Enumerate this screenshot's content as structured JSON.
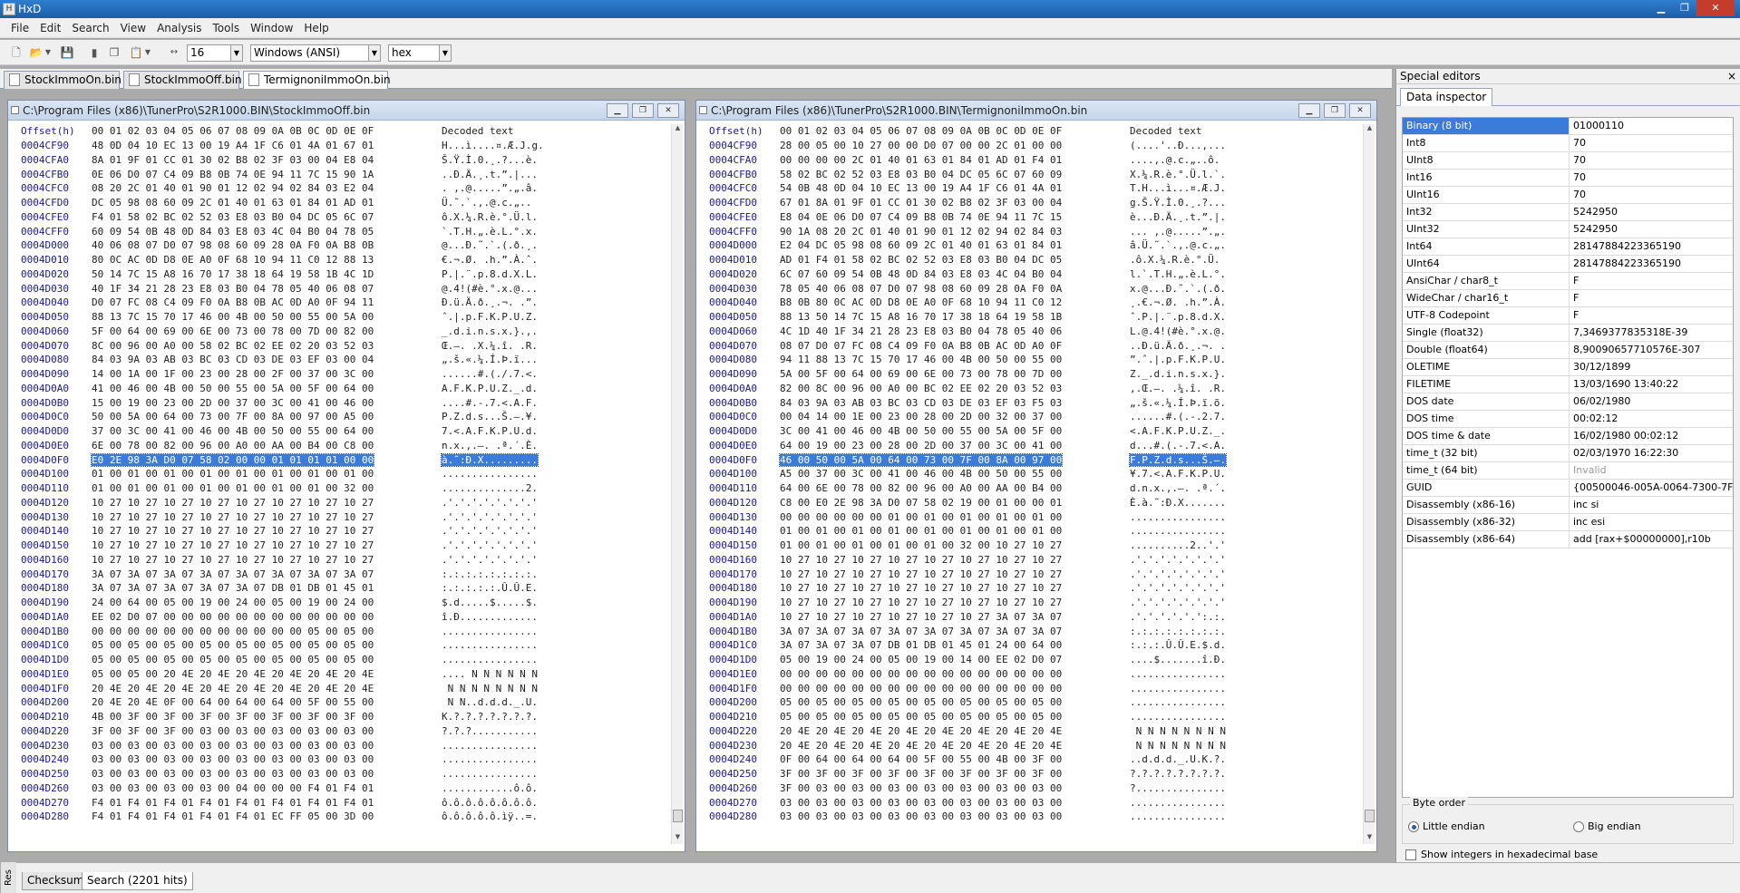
{
  "window": {
    "title": "HxD"
  },
  "menu": [
    "File",
    "Edit",
    "Search",
    "View",
    "Analysis",
    "Tools",
    "Window",
    "Help"
  ],
  "toolbar": {
    "bytes_per_row": "16",
    "charset": "Windows (ANSI)",
    "offset_base": "hex"
  },
  "tabs": [
    "StockImmoOn.bin",
    "StockImmoOff.bin",
    "TermignoniImmoOn.bin"
  ],
  "active_tab": 2,
  "header": {
    "offset": "Offset(h)",
    "cols": "00 01 02 03 04 05 06 07 08 09 0A 0B 0C 0D 0E 0F",
    "decoded": "Decoded text"
  },
  "left": {
    "path": "C:\\Program Files (x86)\\TunerPro\\S2R1000.BIN\\StockImmoOff.bin",
    "selected_row": 22,
    "rows": [
      [
        "0004CF90",
        "48 0D 04 10 EC 13 00 19 A4 1F C6 01 4A 01 67 01",
        "H...ì....¤.Æ.J.g."
      ],
      [
        "0004CFA0",
        "8A 01 9F 01 CC 01 30 02 B8 02 3F 03 00 04 E8 04",
        "Š.Ÿ.Ì.0.¸.?...è."
      ],
      [
        "0004CFB0",
        "0E 06 D0 07 C4 09 B8 0B 74 0E 94 11 7C 15 90 1A",
        "..Ð.Ä.¸.t.”.|..."
      ],
      [
        "0004CFC0",
        "08 20 2C 01 40 01 90 01 12 02 94 02 84 03 E2 04",
        ". ,.@.....”.„.â."
      ],
      [
        "0004CFD0",
        "DC 05 98 08 60 09 2C 01 40 01 63 01 84 01 AD 01",
        "Ü.˜.`.,.@.c.„.­."
      ],
      [
        "0004CFE0",
        "F4 01 58 02 BC 02 52 03 E8 03 B0 04 DC 05 6C 07",
        "ô.X.¼.R.è.°.Ü.l."
      ],
      [
        "0004CFF0",
        "60 09 54 0B 48 0D 84 03 E8 03 4C 04 B0 04 78 05",
        "`.T.H.„.è.L.°.x."
      ],
      [
        "0004D000",
        "40 06 08 07 D0 07 98 08 60 09 28 0A F0 0A B8 0B",
        "@...Ð.˜.`.(.ð.¸."
      ],
      [
        "0004D010",
        "80 0C AC 0D D8 0E A0 0F 68 10 94 11 C0 12 88 13",
        "€.¬.Ø. .h.”.À.ˆ."
      ],
      [
        "0004D020",
        "50 14 7C 15 A8 16 70 17 38 18 64 19 58 1B 4C 1D",
        "P.|.¨.p.8.d.X.L."
      ],
      [
        "0004D030",
        "40 1F 34 21 28 23 E8 03 B0 04 78 05 40 06 08 07",
        "@.4!(#è.°.x.@..."
      ],
      [
        "0004D040",
        "D0 07 FC 08 C4 09 F0 0A B8 0B AC 0D A0 0F 94 11",
        "Ð.ü.Ä.ð.¸.¬. .”."
      ],
      [
        "0004D050",
        "88 13 7C 15 70 17 46 00 4B 00 50 00 55 00 5A 00",
        "ˆ.|.p.F.K.P.U.Z."
      ],
      [
        "0004D060",
        "5F 00 64 00 69 00 6E 00 73 00 78 00 7D 00 82 00",
        "_.d.i.n.s.x.}.‚."
      ],
      [
        "0004D070",
        "8C 00 96 00 A0 00 58 02 BC 02 EE 02 20 03 52 03",
        "Œ.–. .X.¼.î. .R."
      ],
      [
        "0004D080",
        "84 03 9A 03 AB 03 BC 03 CD 03 DE 03 EF 03 00 04",
        "„.š.«.¼.Í.Þ.ï..."
      ],
      [
        "0004D090",
        "14 00 1A 00 1F 00 23 00 28 00 2F 00 37 00 3C 00",
        "......#.(./.7.<."
      ],
      [
        "0004D0A0",
        "41 00 46 00 4B 00 50 00 55 00 5A 00 5F 00 64 00",
        "A.F.K.P.U.Z._.d."
      ],
      [
        "0004D0B0",
        "15 00 19 00 23 00 2D 00 37 00 3C 00 41 00 46 00",
        "....#.-.7.<.A.F."
      ],
      [
        "0004D0C0",
        "50 00 5A 00 64 00 73 00 7F 00 8A 00 97 00 A5 00",
        "P.Z.d.s...Š.—.¥."
      ],
      [
        "0004D0D0",
        "37 00 3C 00 41 00 46 00 4B 00 50 00 55 00 64 00",
        "7.<.A.F.K.P.U.d."
      ],
      [
        "0004D0E0",
        "6E 00 78 00 82 00 96 00 A0 00 AA 00 B4 00 C8 00",
        "n.x.‚.–. .ª.´.È."
      ],
      [
        "0004D0F0",
        "E0 2E 98 3A D0 07 58 02 00 00 01 01 01 01 00 00",
        "à.˜:Ð.X........."
      ],
      [
        "0004D100",
        "01 00 01 00 01 00 01 00 01 00 01 00 01 00 01 00",
        "................"
      ],
      [
        "0004D110",
        "01 00 01 00 01 00 01 00 01 00 01 00 01 00 32 00",
        "..............2."
      ],
      [
        "0004D120",
        "10 27 10 27 10 27 10 27 10 27 10 27 10 27 10 27",
        ".'.'.'.'.'.'.'.'"
      ],
      [
        "0004D130",
        "10 27 10 27 10 27 10 27 10 27 10 27 10 27 10 27",
        ".'.'.'.'.'.'.'.'"
      ],
      [
        "0004D140",
        "10 27 10 27 10 27 10 27 10 27 10 27 10 27 10 27",
        ".'.'.'.'.'.'.'.'"
      ],
      [
        "0004D150",
        "10 27 10 27 10 27 10 27 10 27 10 27 10 27 10 27",
        ".'.'.'.'.'.'.'.'"
      ],
      [
        "0004D160",
        "10 27 10 27 10 27 10 27 10 27 10 27 10 27 10 27",
        ".'.'.'.'.'.'.'.'"
      ],
      [
        "0004D170",
        "3A 07 3A 07 3A 07 3A 07 3A 07 3A 07 3A 07 3A 07",
        ":.:.:.:.:.:.:.:."
      ],
      [
        "0004D180",
        "3A 07 3A 07 3A 07 3A 07 3A 07 DB 01 DB 01 45 01",
        ":.:.:.:.:.Û.Û.E."
      ],
      [
        "0004D190",
        "24 00 64 00 05 00 19 00 24 00 05 00 19 00 24 00",
        "$.d.....$.....$."
      ],
      [
        "0004D1A0",
        "EE 02 D0 07 00 00 00 00 00 00 00 00 00 00 00 00",
        "î.Ð............."
      ],
      [
        "0004D1B0",
        "00 00 00 00 00 00 00 00 00 00 00 00 05 00 05 00",
        "................"
      ],
      [
        "0004D1C0",
        "05 00 05 00 05 00 05 00 05 00 05 00 05 00 05 00",
        "................"
      ],
      [
        "0004D1D0",
        "05 00 05 00 05 00 05 00 05 00 05 00 05 00 05 00",
        "................"
      ],
      [
        "0004D1E0",
        "05 00 05 00 20 4E 20 4E 20 4E 20 4E 20 4E 20 4E",
        ".... N N N N N N"
      ],
      [
        "0004D1F0",
        "20 4E 20 4E 20 4E 20 4E 20 4E 20 4E 20 4E 20 4E",
        " N N N N N N N N"
      ],
      [
        "0004D200",
        "20 4E 20 4E 0F 00 64 00 64 00 64 00 5F 00 55 00",
        " N N..d.d.d._.U."
      ],
      [
        "0004D210",
        "4B 00 3F 00 3F 00 3F 00 3F 00 3F 00 3F 00 3F 00",
        "K.?.?.?.?.?.?.?."
      ],
      [
        "0004D220",
        "3F 00 3F 00 3F 00 03 00 03 00 03 00 03 00 03 00",
        "?.?.?..........."
      ],
      [
        "0004D230",
        "03 00 03 00 03 00 03 00 03 00 03 00 03 00 03 00",
        "................"
      ],
      [
        "0004D240",
        "03 00 03 00 03 00 03 00 03 00 03 00 03 00 03 00",
        "................"
      ],
      [
        "0004D250",
        "03 00 03 00 03 00 03 00 03 00 03 00 03 00 03 00",
        "................"
      ],
      [
        "0004D260",
        "03 00 03 00 03 00 03 00 04 00 00 00 F4 01 F4 01",
        "............ô.ô."
      ],
      [
        "0004D270",
        "F4 01 F4 01 F4 01 F4 01 F4 01 F4 01 F4 01 F4 01",
        "ô.ô.ô.ô.ô.ô.ô.ô."
      ],
      [
        "0004D280",
        "F4 01 F4 01 F4 01 F4 01 F4 01 EC FF 05 00 3D 00",
        "ô.ô.ô.ô.ô.ìÿ..=."
      ]
    ]
  },
  "right": {
    "path": "C:\\Program Files (x86)\\TunerPro\\S2R1000.BIN\\TermignoniImmoOn.bin",
    "selected_row": 22,
    "rows": [
      [
        "0004CF90",
        "28 00 05 00 10 27 00 00 D0 07 00 00 2C 01 00 00",
        "(....'..Ð...,..."
      ],
      [
        "0004CFA0",
        "00 00 00 00 2C 01 40 01 63 01 84 01 AD 01 F4 01",
        "....,.@.c.„.­.ô."
      ],
      [
        "0004CFB0",
        "58 02 BC 02 52 03 E8 03 B0 04 DC 05 6C 07 60 09",
        "X.¼.R.è.°.Ü.l.`."
      ],
      [
        "0004CFC0",
        "54 0B 48 0D 04 10 EC 13 00 19 A4 1F C6 01 4A 01",
        "T.H...ì...¤.Æ.J."
      ],
      [
        "0004CFD0",
        "67 01 8A 01 9F 01 CC 01 30 02 B8 02 3F 03 00 04",
        "g.Š.Ÿ.Ì.0.¸.?..."
      ],
      [
        "0004CFE0",
        "E8 04 0E 06 D0 07 C4 09 B8 0B 74 0E 94 11 7C 15",
        "è...Ð.Ä.¸.t.”.|."
      ],
      [
        "0004CFF0",
        "90 1A 08 20 2C 01 40 01 90 01 12 02 94 02 84 03",
        "... ,.@.....”.„."
      ],
      [
        "0004D000",
        "E2 04 DC 05 98 08 60 09 2C 01 40 01 63 01 84 01",
        "â.Ü.˜.`.,.@.c.„."
      ],
      [
        "0004D010",
        "AD 01 F4 01 58 02 BC 02 52 03 E8 03 B0 04 DC 05",
        "­.ô.X.¼.R.è.°.Ü."
      ],
      [
        "0004D020",
        "6C 07 60 09 54 0B 48 0D 84 03 E8 03 4C 04 B0 04",
        "l.`.T.H.„.è.L.°."
      ],
      [
        "0004D030",
        "78 05 40 06 08 07 D0 07 98 08 60 09 28 0A F0 0A",
        "x.@...Ð.˜.`.(.ð."
      ],
      [
        "0004D040",
        "B8 0B 80 0C AC 0D D8 0E A0 0F 68 10 94 11 C0 12",
        "¸.€.¬.Ø. .h.”.À."
      ],
      [
        "0004D050",
        "88 13 50 14 7C 15 A8 16 70 17 38 18 64 19 58 1B",
        "ˆ.P.|.¨.p.8.d.X."
      ],
      [
        "0004D060",
        "4C 1D 40 1F 34 21 28 23 E8 03 B0 04 78 05 40 06",
        "L.@.4!(#è.°.x.@."
      ],
      [
        "0004D070",
        "08 07 D0 07 FC 08 C4 09 F0 0A B8 0B AC 0D A0 0F",
        "..Ð.ü.Ä.ð.¸.¬. ."
      ],
      [
        "0004D080",
        "94 11 88 13 7C 15 70 17 46 00 4B 00 50 00 55 00",
        "”.ˆ.|.p.F.K.P.U."
      ],
      [
        "0004D090",
        "5A 00 5F 00 64 00 69 00 6E 00 73 00 78 00 7D 00",
        "Z._.d.i.n.s.x.}."
      ],
      [
        "0004D0A0",
        "82 00 8C 00 96 00 A0 00 BC 02 EE 02 20 03 52 03",
        "‚.Œ.–. .¼.î. .R."
      ],
      [
        "0004D0B0",
        "84 03 9A 03 AB 03 BC 03 CD 03 DE 03 EF 03 F5 03",
        "„.š.«.¼.Í.Þ.ï.õ."
      ],
      [
        "0004D0C0",
        "00 04 14 00 1E 00 23 00 28 00 2D 00 32 00 37 00",
        "......#.(.-.2.7."
      ],
      [
        "0004D0D0",
        "3C 00 41 00 46 00 4B 00 50 00 55 00 5A 00 5F 00",
        "<.A.F.K.P.U.Z._."
      ],
      [
        "0004D0E0",
        "64 00 19 00 23 00 28 00 2D 00 37 00 3C 00 41 00",
        "d...#.(.-.7.<.A."
      ],
      [
        "0004D0F0",
        "46 00 50 00 5A 00 64 00 73 00 7F 00 8A 00 97 00",
        "F.P.Z.d.s...Š.—."
      ],
      [
        "0004D100",
        "A5 00 37 00 3C 00 41 00 46 00 4B 00 50 00 55 00",
        "¥.7.<.A.F.K.P.U."
      ],
      [
        "0004D110",
        "64 00 6E 00 78 00 82 00 96 00 A0 00 AA 00 B4 00",
        "d.n.x.‚.–. .ª.´."
      ],
      [
        "0004D120",
        "C8 00 E0 2E 98 3A D0 07 58 02 19 00 01 00 00 01",
        "È.à.˜:Ð.X......."
      ],
      [
        "0004D130",
        "00 00 00 00 00 00 01 00 01 00 01 00 01 00 01 00",
        "................"
      ],
      [
        "0004D140",
        "01 00 01 00 01 00 01 00 01 00 01 00 01 00 01 00",
        "................"
      ],
      [
        "0004D150",
        "01 00 01 00 01 00 01 00 01 00 32 00 10 27 10 27",
        "..........2..'.'"
      ],
      [
        "0004D160",
        "10 27 10 27 10 27 10 27 10 27 10 27 10 27 10 27",
        ".'.'.'.'.'.'.'.'"
      ],
      [
        "0004D170",
        "10 27 10 27 10 27 10 27 10 27 10 27 10 27 10 27",
        ".'.'.'.'.'.'.'.'"
      ],
      [
        "0004D180",
        "10 27 10 27 10 27 10 27 10 27 10 27 10 27 10 27",
        ".'.'.'.'.'.'.'.'"
      ],
      [
        "0004D190",
        "10 27 10 27 10 27 10 27 10 27 10 27 10 27 10 27",
        ".'.'.'.'.'.'.'.'"
      ],
      [
        "0004D1A0",
        "10 27 10 27 10 27 10 27 10 27 10 27 3A 07 3A 07",
        ".'.'.'.'.'.':.:."
      ],
      [
        "0004D1B0",
        "3A 07 3A 07 3A 07 3A 07 3A 07 3A 07 3A 07 3A 07",
        ":.:.:.:.:.:.:.:."
      ],
      [
        "0004D1C0",
        "3A 07 3A 07 3A 07 DB 01 DB 01 45 01 24 00 64 00",
        ":.:.:.Û.Û.E.$.d."
      ],
      [
        "0004D1D0",
        "05 00 19 00 24 00 05 00 19 00 14 00 EE 02 D0 07",
        "....$.......î.Ð."
      ],
      [
        "0004D1E0",
        "00 00 00 00 00 00 00 00 00 00 00 00 00 00 00 00",
        "................"
      ],
      [
        "0004D1F0",
        "00 00 00 00 00 00 00 00 00 00 00 00 00 00 00 00",
        "................"
      ],
      [
        "0004D200",
        "05 00 05 00 05 00 05 00 05 00 05 00 05 00 05 00",
        "................"
      ],
      [
        "0004D210",
        "05 00 05 00 05 00 05 00 05 00 05 00 05 00 05 00",
        "................"
      ],
      [
        "0004D220",
        "20 4E 20 4E 20 4E 20 4E 20 4E 20 4E 20 4E 20 4E",
        " N N N N N N N N"
      ],
      [
        "0004D230",
        "20 4E 20 4E 20 4E 20 4E 20 4E 20 4E 20 4E 20 4E",
        " N N N N N N N N"
      ],
      [
        "0004D240",
        "0F 00 64 00 64 00 64 00 5F 00 55 00 4B 00 3F 00",
        "..d.d.d._.U.K.?."
      ],
      [
        "0004D250",
        "3F 00 3F 00 3F 00 3F 00 3F 00 3F 00 3F 00 3F 00",
        "?.?.?.?.?.?.?.?."
      ],
      [
        "0004D260",
        "3F 00 03 00 03 00 03 00 03 00 03 00 03 00 03 00",
        "?..............."
      ],
      [
        "0004D270",
        "03 00 03 00 03 00 03 00 03 00 03 00 03 00 03 00",
        "................"
      ],
      [
        "0004D280",
        "03 00 03 00 03 00 03 00 03 00 03 00 03 00 03 00",
        "................"
      ]
    ]
  },
  "special_editors": {
    "title": "Special editors",
    "close": "×",
    "tab": "Data inspector",
    "inspector": [
      [
        "Binary (8 bit)",
        "01000110"
      ],
      [
        "Int8",
        "70"
      ],
      [
        "UInt8",
        "70"
      ],
      [
        "Int16",
        "70"
      ],
      [
        "UInt16",
        "70"
      ],
      [
        "Int32",
        "5242950"
      ],
      [
        "UInt32",
        "5242950"
      ],
      [
        "Int64",
        "28147884223365190"
      ],
      [
        "UInt64",
        "28147884223365190"
      ],
      [
        "AnsiChar / char8_t",
        "F"
      ],
      [
        "WideChar / char16_t",
        "F"
      ],
      [
        "UTF-8 Codepoint",
        "F"
      ],
      [
        "Single (float32)",
        "7,3469377835318E-39"
      ],
      [
        "Double (float64)",
        "8,90090657710576E-307"
      ],
      [
        "OLETIME",
        "30/12/1899"
      ],
      [
        "FILETIME",
        "13/03/1690 13:40:22"
      ],
      [
        "DOS date",
        "06/02/1980"
      ],
      [
        "DOS time",
        "00:02:12"
      ],
      [
        "DOS time & date",
        "16/02/1980 00:02:12"
      ],
      [
        "time_t (32 bit)",
        "02/03/1970 16:22:30"
      ],
      [
        "time_t (64 bit)",
        "Invalid"
      ],
      [
        "GUID",
        "{00500046-005A-0064-7300-7F008A009700}"
      ],
      [
        "Disassembly (x86-16)",
        "inc si"
      ],
      [
        "Disassembly (x86-32)",
        "inc esi"
      ],
      [
        "Disassembly (x86-64)",
        "add [rax+$00000000],r10b"
      ]
    ],
    "byte_order": {
      "label": "Byte order",
      "little": "Little endian",
      "big": "Big endian",
      "selected": "little"
    },
    "hex_option": "Show integers in hexadecimal base"
  },
  "bottom_tabs": [
    "Checksum",
    "Search (2201 hits)"
  ],
  "bottom_side_label": "Res"
}
